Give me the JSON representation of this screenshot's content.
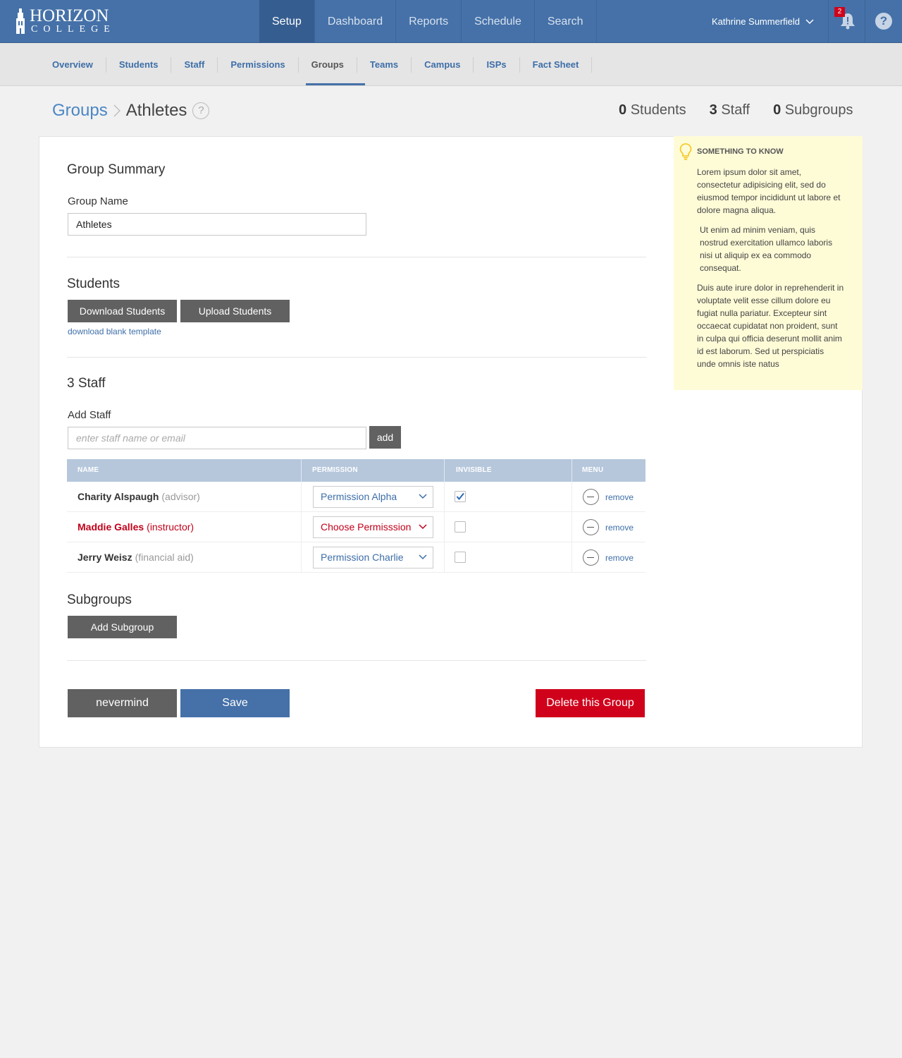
{
  "brand": {
    "line1": "HORIZON",
    "line2": "COLLEGE"
  },
  "mainnav": [
    "Setup",
    "Dashboard",
    "Reports",
    "Schedule",
    "Search"
  ],
  "user": {
    "name": "Kathrine Summerfield",
    "notifications": "2"
  },
  "subnav": [
    "Overview",
    "Students",
    "Staff",
    "Permissions",
    "Groups",
    "Teams",
    "Campus",
    "ISPs",
    "Fact Sheet"
  ],
  "breadcrumb": {
    "parent": "Groups",
    "current": "Athletes",
    "help": "?"
  },
  "counts": [
    {
      "num": "0",
      "label": "Students"
    },
    {
      "num": "3",
      "label": "Staff"
    },
    {
      "num": "0",
      "label": "Subgroups"
    }
  ],
  "summary": {
    "title": "Group Summary",
    "name_label": "Group Name",
    "name_value": "Athletes"
  },
  "students": {
    "title": "Students",
    "download": "Download Students",
    "upload": "Upload Students",
    "template_link": "download blank template"
  },
  "staff": {
    "title": "3 Staff",
    "add_label": "Add Staff",
    "add_placeholder": "enter staff name or email",
    "add_button": "add",
    "columns": [
      "NAME",
      "PERMISSION",
      "INVISIBLE",
      "MENU"
    ],
    "rows": [
      {
        "name": "Charity Alspaugh",
        "role": "(advisor)",
        "permission": "Permission Alpha",
        "invisible": true,
        "action": "remove",
        "error": false
      },
      {
        "name": "Maddie Galles",
        "role": "(instructor)",
        "permission": "Choose Permisssion",
        "invisible": false,
        "action": "remove",
        "error": true
      },
      {
        "name": "Jerry Weisz",
        "role": "(financial aid)",
        "permission": "Permission Charlie",
        "invisible": false,
        "action": "remove",
        "error": false
      }
    ]
  },
  "subgroups": {
    "title": "Subgroups",
    "add": "Add Subgroup"
  },
  "footer": {
    "cancel": "nevermind",
    "save": "Save",
    "delete": "Delete this Group"
  },
  "tip": {
    "title": "SOMETHING TO KNOW",
    "p1": "Lorem ipsum dolor sit amet, consectetur adipisicing elit, sed do eiusmod tempor incididunt ut labore et dolore magna aliqua.",
    "p2": "Ut enim ad minim veniam, quis nostrud exercitation ullamco laboris nisi ut aliquip ex ea commodo consequat.",
    "p3": "Duis aute irure dolor in reprehenderit in voluptate velit esse cillum dolore eu fugiat nulla pariatur. Excepteur sint occaecat cupidatat non proident, sunt in culpa qui officia deserunt mollit anim id est laborum. Sed ut perspiciatis unde omnis iste natus"
  },
  "colors": {
    "brand": "#4571a8",
    "error": "#d0021b",
    "tip_bg": "#fefbd7"
  }
}
